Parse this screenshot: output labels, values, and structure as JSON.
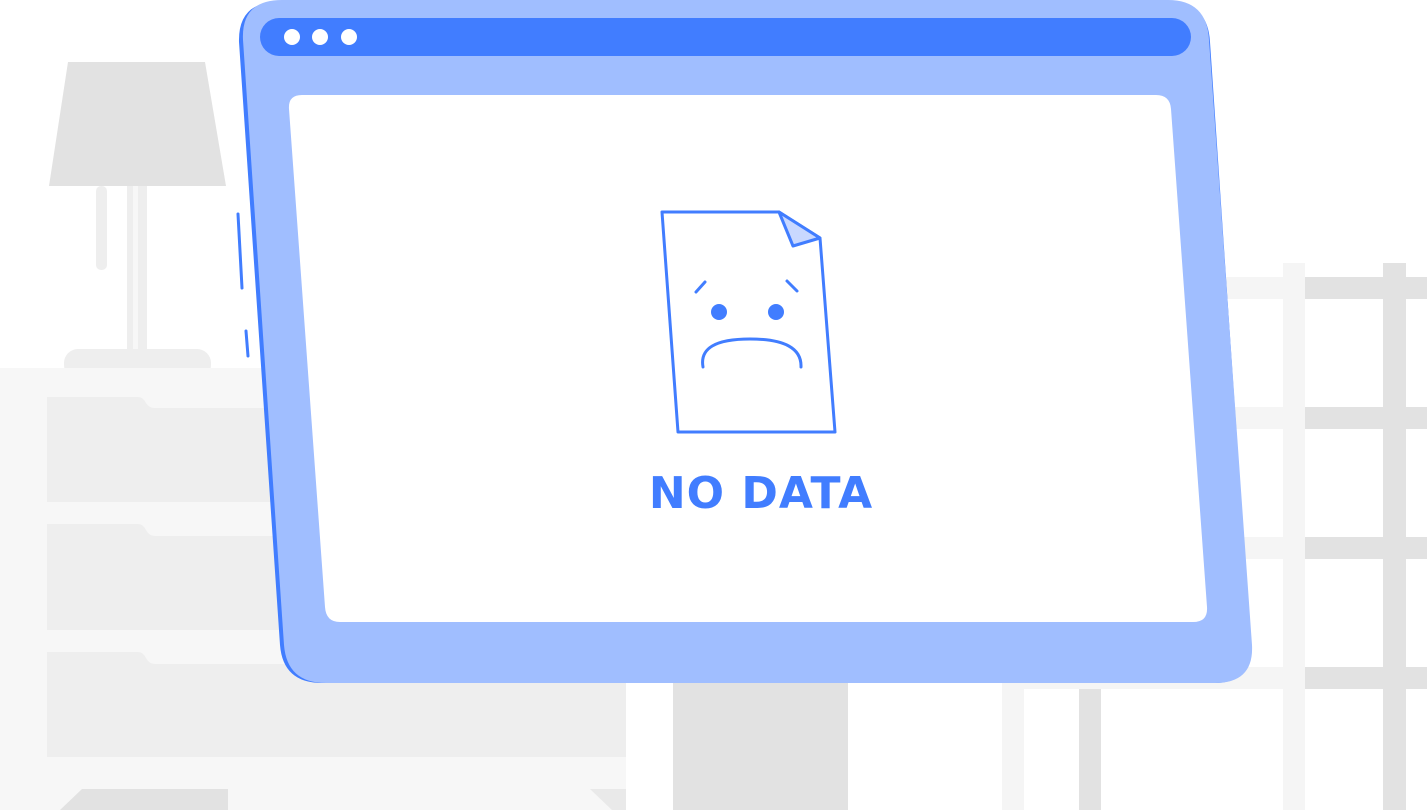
{
  "message": {
    "title": "NO DATA"
  },
  "colors": {
    "accent": "#417DFF",
    "frame": "#A0BEFF",
    "screen": "#FFFFFF",
    "furniture_light": "#F5F5F5",
    "furniture_mid": "#EEEEEE",
    "furniture_dark": "#E2E2E2",
    "page_fill": "#FFFFFF",
    "fold_fill": "#C9D8FF"
  },
  "icons": {
    "browser_dots": [
      "window-dot-icon",
      "window-dot-icon",
      "window-dot-icon"
    ],
    "document": "sad-document-icon",
    "lamp": "lamp-icon",
    "dresser": "dresser-icon",
    "shelf": "shelf-icon"
  }
}
